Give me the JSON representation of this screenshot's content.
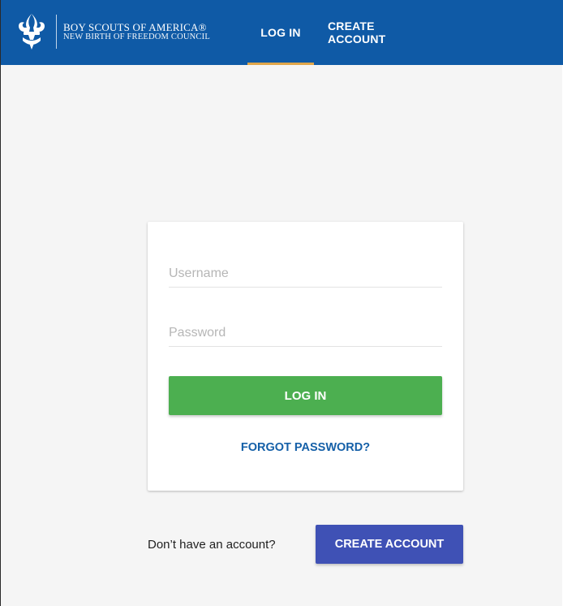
{
  "colors": {
    "header_bg": "#0f5aa6",
    "active_tab_indicator": "#e0a64a",
    "page_bg": "#f5f5f5",
    "login_button": "#4caf50",
    "create_account_button": "#3f51b5",
    "link": "#1560a8"
  },
  "header": {
    "logo_icon": "fleur-de-lis-icon",
    "brand_line1": "BOY SCOUTS OF AMERICA®",
    "brand_line2": "NEW BIRTH OF FREEDOM COUNCIL",
    "tabs": [
      {
        "label": "LOG IN",
        "active": true
      },
      {
        "label": "CREATE ACCOUNT",
        "active": false
      }
    ]
  },
  "login_card": {
    "username": {
      "placeholder": "Username",
      "value": ""
    },
    "password": {
      "placeholder": "Password",
      "value": ""
    },
    "login_button": "LOG IN",
    "forgot_password": "FORGOT PASSWORD?"
  },
  "signup": {
    "prompt": "Don’t have an account?",
    "button": "CREATE ACCOUNT"
  }
}
